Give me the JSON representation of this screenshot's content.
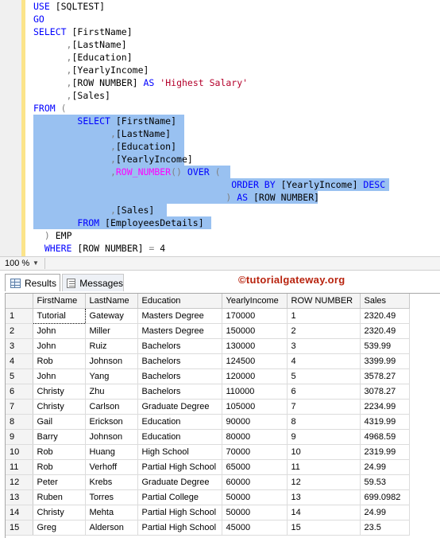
{
  "editor": {
    "lines": [
      [
        {
          "t": "USE",
          "c": "kw"
        },
        {
          "t": " [SQLTEST]"
        }
      ],
      [
        {
          "t": "GO",
          "c": "kw"
        }
      ],
      [
        {
          "t": "SELECT",
          "c": "kw"
        },
        {
          "t": " [FirstName]"
        }
      ],
      [
        {
          "t": "      "
        },
        {
          "t": ",",
          "c": "gr"
        },
        {
          "t": "[LastName]"
        }
      ],
      [
        {
          "t": "      "
        },
        {
          "t": ",",
          "c": "gr"
        },
        {
          "t": "[Education]"
        }
      ],
      [
        {
          "t": "      "
        },
        {
          "t": ",",
          "c": "gr"
        },
        {
          "t": "[YearlyIncome]"
        }
      ],
      [
        {
          "t": "      "
        },
        {
          "t": ",",
          "c": "gr"
        },
        {
          "t": "[ROW NUMBER] "
        },
        {
          "t": "AS",
          "c": "kw"
        },
        {
          "t": " "
        },
        {
          "t": "'Highest Salary'",
          "c": "str"
        }
      ],
      [
        {
          "t": "      "
        },
        {
          "t": ",",
          "c": "gr"
        },
        {
          "t": "[Sales]"
        }
      ],
      [
        {
          "t": "FROM",
          "c": "kw"
        },
        {
          "t": " "
        },
        {
          "t": "(",
          "c": "gr"
        }
      ],
      [
        {
          "t": "        "
        },
        {
          "t": "SELECT",
          "c": "kw"
        },
        {
          "t": " [FirstName]"
        }
      ],
      [
        {
          "t": "              "
        },
        {
          "t": ",",
          "c": "gr"
        },
        {
          "t": "[LastName]"
        }
      ],
      [
        {
          "t": "              "
        },
        {
          "t": ",",
          "c": "gr"
        },
        {
          "t": "[Education]"
        }
      ],
      [
        {
          "t": "              "
        },
        {
          "t": ",",
          "c": "gr"
        },
        {
          "t": "[YearlyIncome]"
        }
      ],
      [
        {
          "t": "              "
        },
        {
          "t": ",",
          "c": "gr"
        },
        {
          "t": "ROW_NUMBER",
          "c": "fn"
        },
        {
          "t": "()",
          "c": "gr"
        },
        {
          "t": " "
        },
        {
          "t": "OVER",
          "c": "kw"
        },
        {
          "t": " "
        },
        {
          "t": "(",
          "c": "gr"
        }
      ],
      [
        {
          "t": "                                    "
        },
        {
          "t": "ORDER BY",
          "c": "kw"
        },
        {
          "t": " [YearlyIncome] "
        },
        {
          "t": "DESC",
          "c": "kw"
        }
      ],
      [
        {
          "t": "                                   "
        },
        {
          "t": ")",
          "c": "gr"
        },
        {
          "t": " "
        },
        {
          "t": "AS",
          "c": "kw"
        },
        {
          "t": " [ROW NUMBER]"
        }
      ],
      [
        {
          "t": "              "
        },
        {
          "t": ",",
          "c": "gr"
        },
        {
          "t": "[Sales]"
        }
      ],
      [
        {
          "t": "        "
        },
        {
          "t": "FROM",
          "c": "kw"
        },
        {
          "t": " [EmployeesDetails]"
        }
      ],
      [
        {
          "t": "  "
        },
        {
          "t": ")",
          "c": "gr"
        },
        {
          "t": " EMP"
        }
      ],
      [
        {
          "t": "  "
        },
        {
          "t": "WHERE",
          "c": "kw"
        },
        {
          "t": " [ROW NUMBER] "
        },
        {
          "t": "=",
          "c": "gr"
        },
        {
          "t": " 4"
        }
      ]
    ]
  },
  "zoom": {
    "value": "100 %"
  },
  "tabs": {
    "results": "Results",
    "messages": "Messages"
  },
  "brand": "©tutorialgateway.org",
  "grid": {
    "headers": [
      "FirstName",
      "LastName",
      "Education",
      "YearlyIncome",
      "ROW NUMBER",
      "Sales"
    ],
    "rows": [
      [
        "1",
        "Tutorial",
        "Gateway",
        "Masters Degree",
        "170000",
        "1",
        "2320.49"
      ],
      [
        "2",
        "John",
        "Miller",
        "Masters Degree",
        "150000",
        "2",
        "2320.49"
      ],
      [
        "3",
        "John",
        "Ruiz",
        "Bachelors",
        "130000",
        "3",
        "539.99"
      ],
      [
        "4",
        "Rob",
        "Johnson",
        "Bachelors",
        "124500",
        "4",
        "3399.99"
      ],
      [
        "5",
        "John",
        "Yang",
        "Bachelors",
        "120000",
        "5",
        "3578.27"
      ],
      [
        "6",
        "Christy",
        "Zhu",
        "Bachelors",
        "110000",
        "6",
        "3078.27"
      ],
      [
        "7",
        "Christy",
        "Carlson",
        "Graduate Degree",
        "105000",
        "7",
        "2234.99"
      ],
      [
        "8",
        "Gail",
        "Erickson",
        "Education",
        "90000",
        "8",
        "4319.99"
      ],
      [
        "9",
        "Barry",
        "Johnson",
        "Education",
        "80000",
        "9",
        "4968.59"
      ],
      [
        "10",
        "Rob",
        "Huang",
        "High School",
        "70000",
        "10",
        "2319.99"
      ],
      [
        "11",
        "Rob",
        "Verhoff",
        "Partial High School",
        "65000",
        "11",
        "24.99"
      ],
      [
        "12",
        "Peter",
        "Krebs",
        "Graduate Degree",
        "60000",
        "12",
        "59.53"
      ],
      [
        "13",
        "Ruben",
        "Torres",
        "Partial College",
        "50000",
        "13",
        "699.0982"
      ],
      [
        "14",
        "Christy",
        "Mehta",
        "Partial High School",
        "50000",
        "14",
        "24.99"
      ],
      [
        "15",
        "Greg",
        "Alderson",
        "Partial High School",
        "45000",
        "15",
        "23.5"
      ]
    ]
  }
}
